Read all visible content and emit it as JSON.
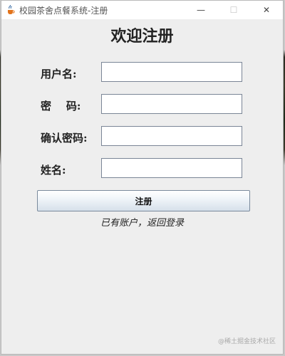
{
  "window": {
    "title": "校园茶舍点餐系统-注册",
    "app_icon": "java-cup-icon",
    "controls": {
      "minimize": "—",
      "maximize": "☐",
      "close": "✕"
    }
  },
  "form": {
    "heading": "欢迎注册",
    "fields": [
      {
        "label": "用户名:",
        "value": ""
      },
      {
        "label": "密    码:",
        "value": ""
      },
      {
        "label": "确认密码:",
        "value": ""
      },
      {
        "label": "姓名:",
        "value": ""
      }
    ],
    "register_button": "注册",
    "login_link": "已有账户，返回登录"
  },
  "watermark": "@稀土掘金技术社区"
}
